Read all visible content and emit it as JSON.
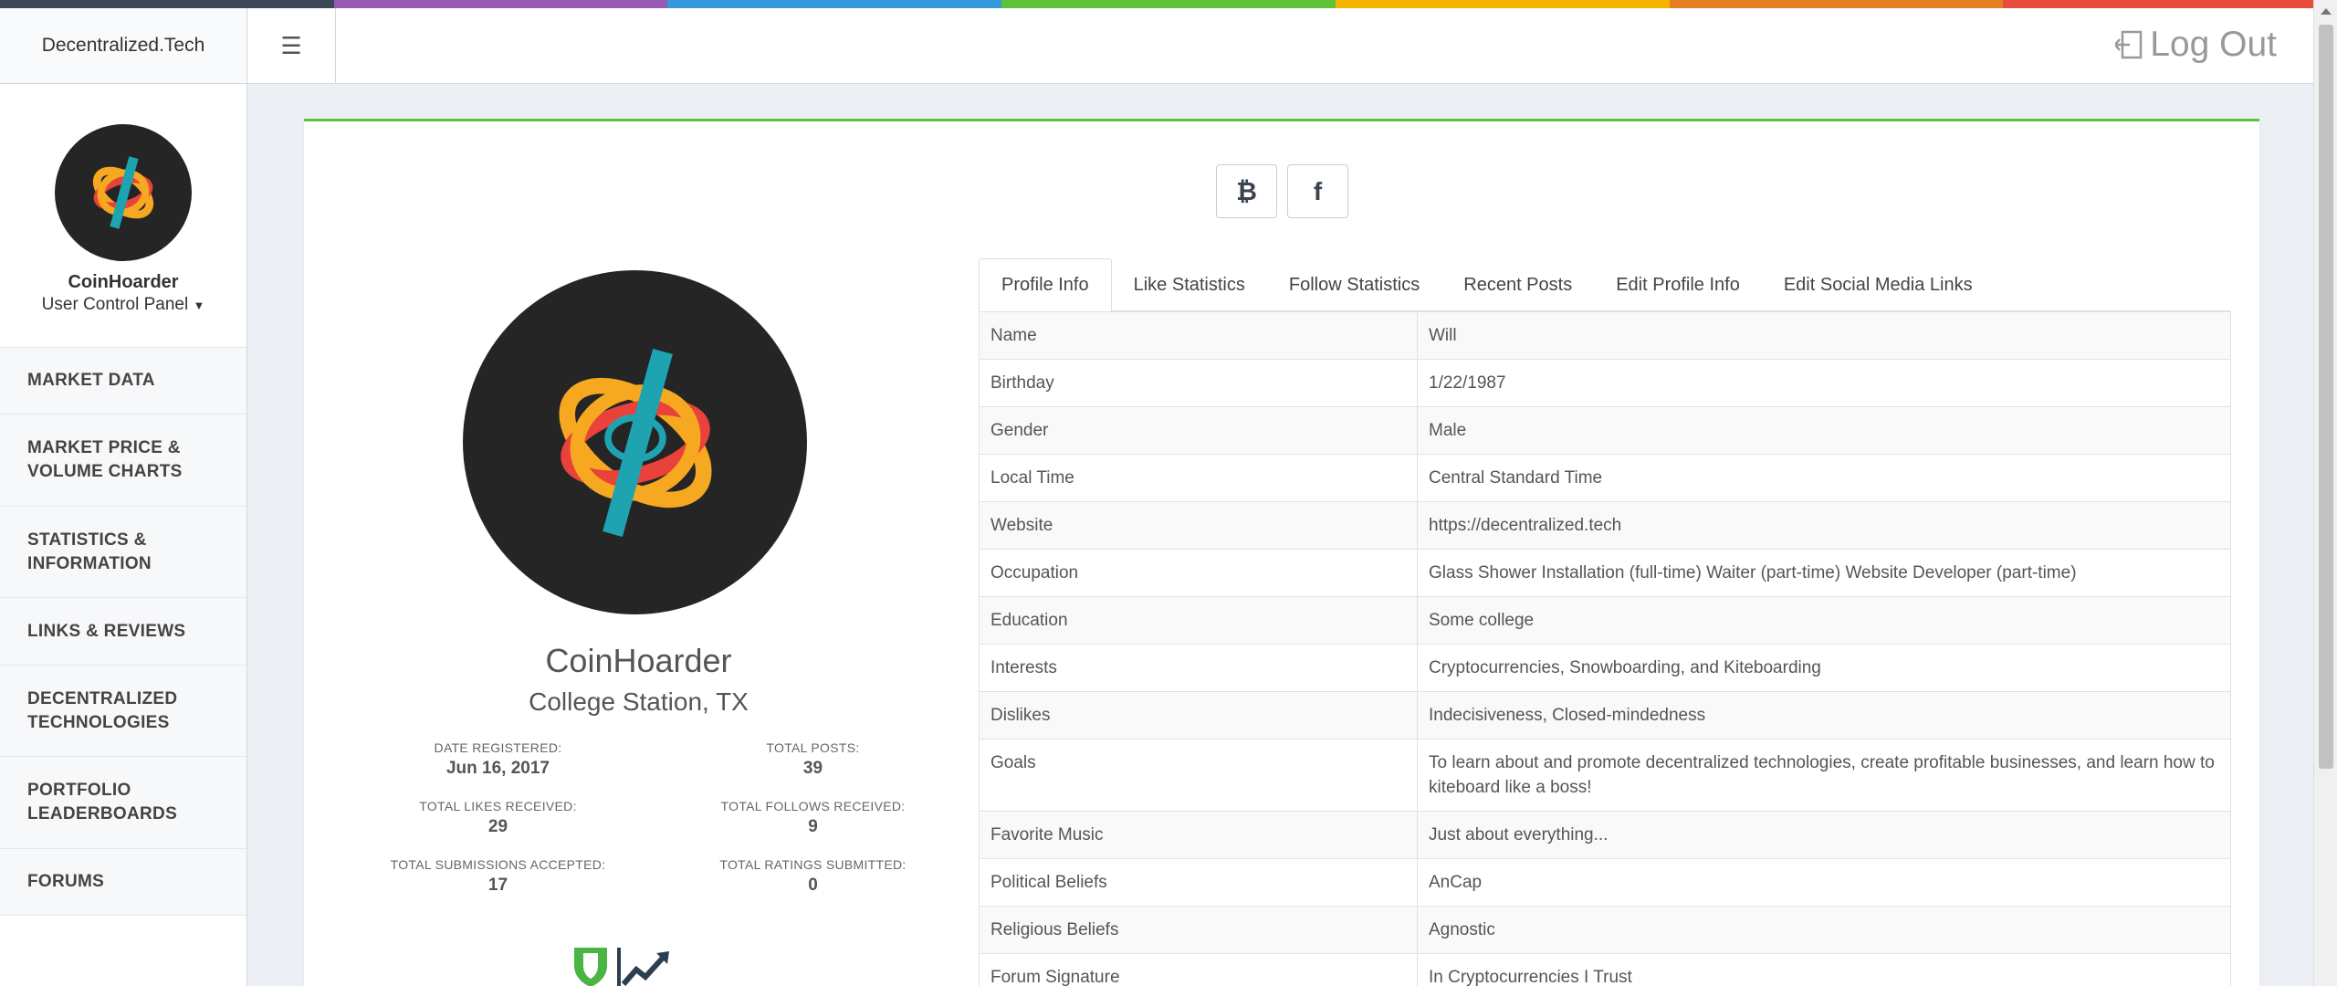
{
  "colors": {
    "rainbow": [
      "#3c4758",
      "#9b59b6",
      "#3498db",
      "#5cc23a",
      "#f5b400",
      "#e67e22",
      "#e74c3c"
    ],
    "accent_green": "#5cc23a",
    "avatar_bg": "#252525"
  },
  "brand": {
    "title": "Decentralized.Tech"
  },
  "header": {
    "menu_icon": "hamburger-icon",
    "logout_label": "Log Out"
  },
  "user_panel": {
    "username": "CoinHoarder",
    "control_panel_label": "User Control Panel"
  },
  "sidebar": {
    "items": [
      {
        "label": "MARKET DATA"
      },
      {
        "label": "MARKET PRICE & VOLUME CHARTS"
      },
      {
        "label": "STATISTICS & INFORMATION"
      },
      {
        "label": "LINKS & REVIEWS"
      },
      {
        "label": "DECENTRALIZED TECHNOLOGIES"
      },
      {
        "label": "PORTFOLIO LEADERBOARDS"
      },
      {
        "label": "FORUMS"
      }
    ]
  },
  "social": {
    "bitcoin_glyph": "₿",
    "facebook_glyph": "f"
  },
  "profile": {
    "name": "CoinHoarder",
    "location": "College Station, TX",
    "stats": [
      {
        "label": "DATE REGISTERED:",
        "value": "Jun 16, 2017"
      },
      {
        "label": "TOTAL POSTS:",
        "value": "39"
      },
      {
        "label": "TOTAL LIKES RECEIVED:",
        "value": "29"
      },
      {
        "label": "TOTAL FOLLOWS RECEIVED:",
        "value": "9"
      },
      {
        "label": "TOTAL SUBMISSIONS ACCEPTED:",
        "value": "17"
      },
      {
        "label": "TOTAL RATINGS SUBMITTED:",
        "value": "0"
      }
    ]
  },
  "tabs": [
    {
      "label": "Profile Info"
    },
    {
      "label": "Like Statistics"
    },
    {
      "label": "Follow Statistics"
    },
    {
      "label": "Recent Posts"
    },
    {
      "label": "Edit Profile Info"
    },
    {
      "label": "Edit Social Media Links"
    }
  ],
  "info_rows": [
    {
      "field": "Name",
      "value": "Will"
    },
    {
      "field": "Birthday",
      "value": "1/22/1987"
    },
    {
      "field": "Gender",
      "value": "Male"
    },
    {
      "field": "Local Time",
      "value": "Central Standard Time"
    },
    {
      "field": "Website",
      "value": "https://decentralized.tech"
    },
    {
      "field": "Occupation",
      "value": "Glass Shower Installation (full-time) Waiter (part-time) Website Developer (part-time)"
    },
    {
      "field": "Education",
      "value": "Some college"
    },
    {
      "field": "Interests",
      "value": "Cryptocurrencies, Snowboarding, and Kiteboarding"
    },
    {
      "field": "Dislikes",
      "value": "Indecisiveness, Closed-mindedness"
    },
    {
      "field": "Goals",
      "value": "To learn about and promote decentralized technologies, create profitable businesses, and learn how to kiteboard like a boss!"
    },
    {
      "field": "Favorite Music",
      "value": "Just about everything..."
    },
    {
      "field": "Political Beliefs",
      "value": "AnCap"
    },
    {
      "field": "Religious Beliefs",
      "value": "Agnostic"
    },
    {
      "field": "Forum Signature",
      "value": "In Cryptocurrencies I Trust"
    }
  ]
}
